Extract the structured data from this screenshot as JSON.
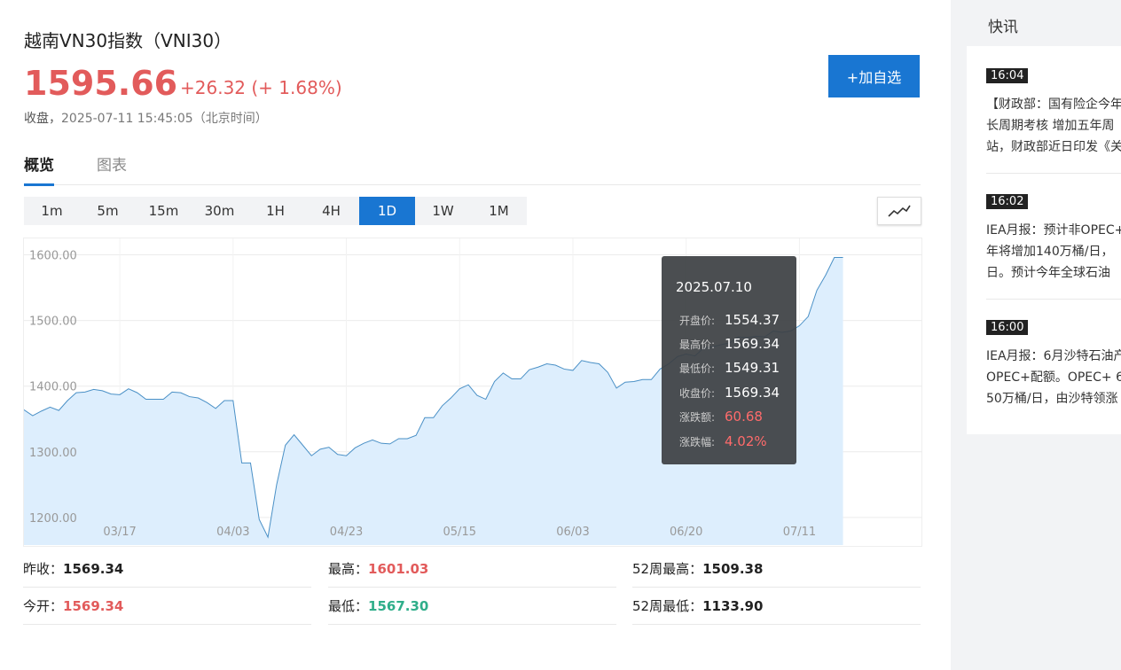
{
  "header": {
    "title": "越南VN30指数（VNI30）",
    "price": "1595.66",
    "change": "+26.32 (+ 1.68%)",
    "close_label": "收盘，",
    "close_time": "2025-07-11 15:45:05（北京时间）",
    "add_button": "+加自选"
  },
  "tabs": [
    {
      "label": "概览",
      "active": true
    },
    {
      "label": "图表",
      "active": false
    }
  ],
  "periods": [
    "1m",
    "5m",
    "15m",
    "30m",
    "1H",
    "4H",
    "1D",
    "1W",
    "1M"
  ],
  "active_period": "1D",
  "icons": {
    "chart_type": "line-chart-icon"
  },
  "colors": {
    "up": "#e25b5b",
    "down": "#2fae8a",
    "accent": "#1976d2",
    "area": "#ddeefd",
    "line": "#4a90c6"
  },
  "chart_data": {
    "type": "area",
    "x": [
      0,
      1,
      2,
      3,
      4,
      5,
      6,
      7,
      8,
      9,
      10,
      11,
      12,
      13,
      14,
      15,
      16,
      17,
      18,
      19,
      20,
      21,
      22,
      23,
      24,
      25,
      26,
      27,
      28,
      29,
      30,
      31,
      32,
      33,
      34,
      35,
      36,
      37,
      38,
      39,
      40,
      41,
      42,
      43,
      44,
      45,
      46,
      47,
      48,
      49,
      50,
      51,
      52,
      53,
      54,
      55,
      56,
      57,
      58,
      59,
      60,
      61,
      62,
      63,
      64,
      65,
      66,
      67,
      68,
      69,
      70,
      71,
      72,
      73,
      74,
      75,
      76,
      77,
      78,
      79,
      80,
      81,
      82,
      83,
      84,
      85,
      86,
      87,
      88,
      89,
      90,
      91,
      92,
      93,
      94
    ],
    "values": [
      1364,
      1355,
      1362,
      1368,
      1363,
      1378,
      1390,
      1391,
      1395,
      1393,
      1388,
      1387,
      1396,
      1390,
      1380,
      1380,
      1380,
      1391,
      1390,
      1384,
      1382,
      1375,
      1366,
      1378,
      1378,
      1283,
      1283,
      1197,
      1170,
      1250,
      1310,
      1326,
      1310,
      1294,
      1304,
      1307,
      1296,
      1294,
      1306,
      1313,
      1318,
      1313,
      1312,
      1320,
      1320,
      1325,
      1352,
      1352,
      1370,
      1382,
      1396,
      1402,
      1386,
      1380,
      1407,
      1420,
      1411,
      1411,
      1425,
      1429,
      1434,
      1432,
      1426,
      1424,
      1439,
      1436,
      1434,
      1421,
      1397,
      1406,
      1407,
      1410,
      1410,
      1426,
      1434,
      1445,
      1449,
      1446,
      1458,
      1460,
      1463,
      1466,
      1475,
      1474,
      1476,
      1475,
      1484,
      1482,
      1484,
      1492,
      1506,
      1546,
      1569,
      1596,
      1596
    ],
    "x_tick_labels": [
      {
        "index": 11,
        "label": "03/17"
      },
      {
        "index": 24,
        "label": "04/03"
      },
      {
        "index": 37,
        "label": "04/23"
      },
      {
        "index": 50,
        "label": "05/15"
      },
      {
        "index": 63,
        "label": "06/03"
      },
      {
        "index": 76,
        "label": "06/20"
      },
      {
        "index": 89,
        "label": "07/11"
      }
    ],
    "y_ticks": [
      1200,
      1300,
      1400,
      1500,
      1600
    ],
    "y_tick_labels": [
      "1200.00",
      "1300.00",
      "1400.00",
      "1500.00",
      "1600.00"
    ],
    "ylim": [
      1158,
      1625
    ],
    "grid": true,
    "title": "",
    "xlabel": "",
    "ylabel": ""
  },
  "tooltip": {
    "date": "2025.07.10",
    "rows": [
      {
        "label": "开盘价:",
        "value": "1554.37",
        "red": false
      },
      {
        "label": "最高价:",
        "value": "1569.34",
        "red": false
      },
      {
        "label": "最低价:",
        "value": "1549.31",
        "red": false
      },
      {
        "label": "收盘价:",
        "value": "1569.34",
        "red": false
      },
      {
        "label": "涨跌额:",
        "value": "60.68",
        "red": true
      },
      {
        "label": "涨跌幅:",
        "value": "4.02%",
        "red": true
      }
    ]
  },
  "stats": {
    "prev_close_label": "昨收：",
    "prev_close": "1569.34",
    "high_label": "最高：",
    "high": "1601.03",
    "w52_high_label": "52周最高：",
    "w52_high": "1509.38",
    "open_label": "今开：",
    "open": "1569.34",
    "low_label": "最低：",
    "low": "1567.30",
    "w52_low_label": "52周最低：",
    "w52_low": "1133.90"
  },
  "news": {
    "title": "快讯",
    "items": [
      {
        "time": "16:04",
        "lines": [
          "【财政部：国有险企今年",
          "长周期考核 增加五年周",
          "站，财政部近日印发《关"
        ]
      },
      {
        "time": "16:02",
        "lines": [
          "IEA月报：预计非OPEC+",
          "年将增加140万桶/日，",
          "日。预计今年全球石油"
        ]
      },
      {
        "time": "16:00",
        "lines": [
          "IEA月报：6月沙特石油产",
          "OPEC+配额。OPEC+ 6",
          "50万桶/日，由沙特领涨"
        ]
      }
    ]
  }
}
